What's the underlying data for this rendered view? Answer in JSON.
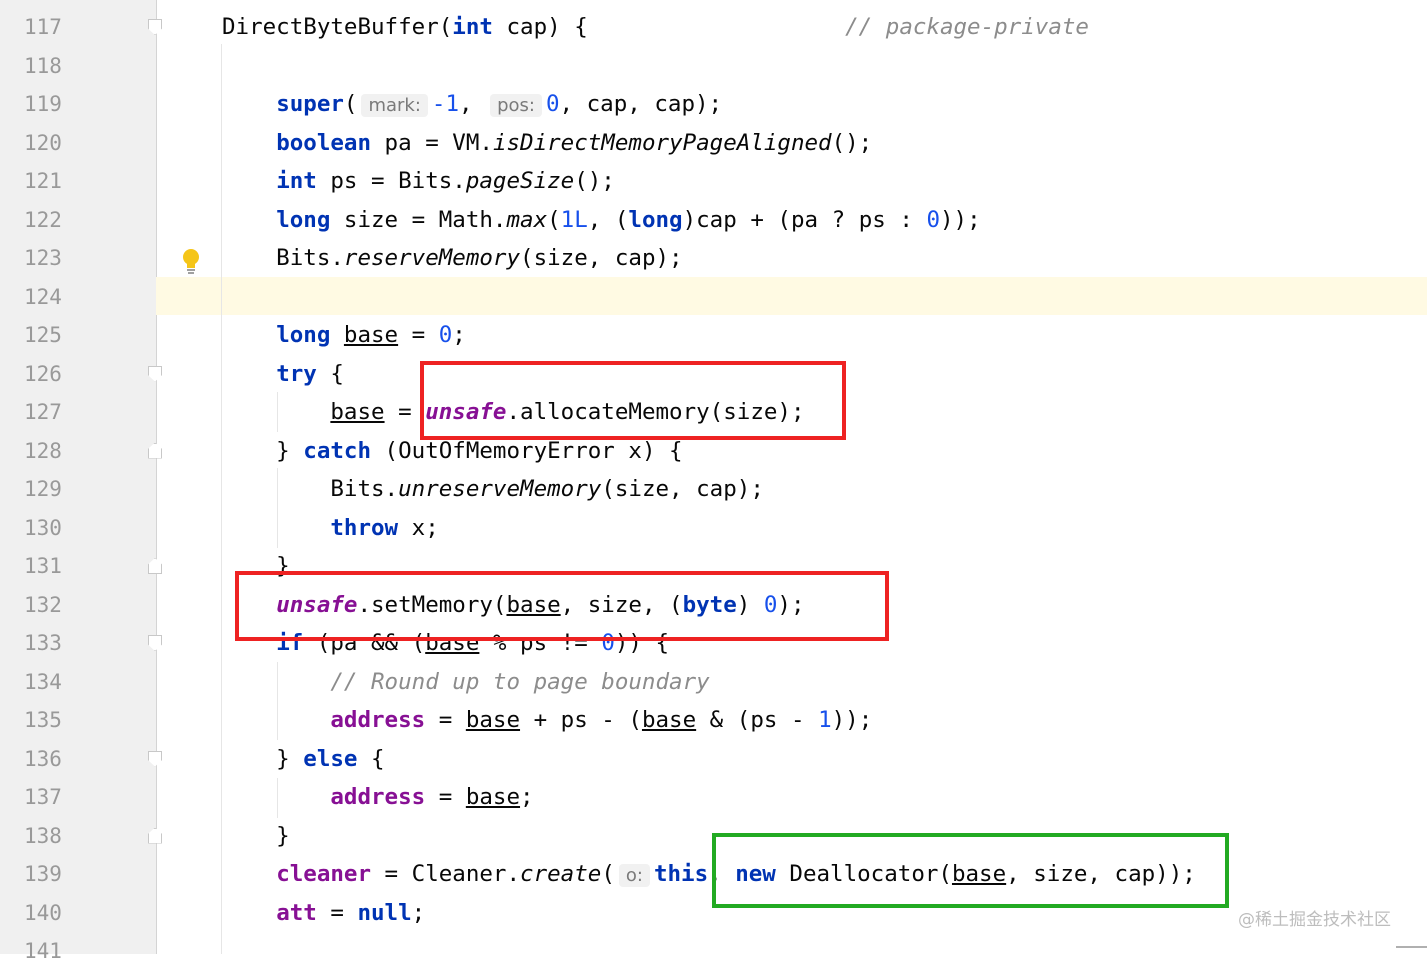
{
  "editor": {
    "line_numbers": [
      "117",
      "118",
      "119",
      "120",
      "121",
      "122",
      "123",
      "124",
      "125",
      "126",
      "127",
      "128",
      "129",
      "130",
      "131",
      "132",
      "133",
      "134",
      "135",
      "136",
      "137",
      "138",
      "139",
      "140",
      "141"
    ],
    "lines": [
      {
        "no": "117",
        "tokens": [
          [
            "p",
            "DirectByteBuffer("
          ],
          [
            "kw",
            "int"
          ],
          [
            "p",
            " cap) {                   "
          ],
          [
            "cmt",
            "// package-private"
          ]
        ]
      },
      {
        "no": "118",
        "tokens": []
      },
      {
        "no": "119",
        "tokens": [
          [
            "p",
            "    "
          ],
          [
            "kw",
            "super"
          ],
          [
            "p",
            "("
          ],
          [
            "hint",
            "mark:"
          ],
          [
            "num",
            "-1"
          ],
          [
            "p",
            ", "
          ],
          [
            "hint",
            "pos:"
          ],
          [
            "num",
            "0"
          ],
          [
            "p",
            ", cap, cap);"
          ]
        ]
      },
      {
        "no": "120",
        "tokens": [
          [
            "p",
            "    "
          ],
          [
            "kw",
            "boolean"
          ],
          [
            "p",
            " pa = VM."
          ],
          [
            "it",
            "isDirectMemoryPageAligned"
          ],
          [
            "p",
            "();"
          ]
        ]
      },
      {
        "no": "121",
        "tokens": [
          [
            "p",
            "    "
          ],
          [
            "kw",
            "int"
          ],
          [
            "p",
            " ps = Bits."
          ],
          [
            "it",
            "pageSize"
          ],
          [
            "p",
            "();"
          ]
        ]
      },
      {
        "no": "122",
        "tokens": [
          [
            "p",
            "    "
          ],
          [
            "kw",
            "long"
          ],
          [
            "p",
            " size = Math."
          ],
          [
            "it",
            "max"
          ],
          [
            "p",
            "("
          ],
          [
            "num",
            "1L"
          ],
          [
            "p",
            ", ("
          ],
          [
            "kw",
            "long"
          ],
          [
            "p",
            ")cap + (pa ? ps : "
          ],
          [
            "num",
            "0"
          ],
          [
            "p",
            "));"
          ]
        ]
      },
      {
        "no": "123",
        "tokens": [
          [
            "p",
            "    Bits."
          ],
          [
            "it",
            "reserveMemory"
          ],
          [
            "p",
            "(size, cap);"
          ]
        ]
      },
      {
        "no": "124",
        "tokens": []
      },
      {
        "no": "125",
        "tokens": [
          [
            "p",
            "    "
          ],
          [
            "kw",
            "long"
          ],
          [
            "p",
            " "
          ],
          [
            "ul",
            "base"
          ],
          [
            "p",
            " = "
          ],
          [
            "num",
            "0"
          ],
          [
            "p",
            ";"
          ]
        ]
      },
      {
        "no": "126",
        "tokens": [
          [
            "p",
            "    "
          ],
          [
            "kw",
            "try"
          ],
          [
            "p",
            " {"
          ]
        ]
      },
      {
        "no": "127",
        "tokens": [
          [
            "p",
            "        "
          ],
          [
            "ul",
            "base"
          ],
          [
            "p",
            " = "
          ],
          [
            "sfld",
            "unsafe"
          ],
          [
            "p",
            ".allocateMemory(size);"
          ]
        ]
      },
      {
        "no": "128",
        "tokens": [
          [
            "p",
            "    } "
          ],
          [
            "kw",
            "catch"
          ],
          [
            "p",
            " (OutOfMemoryError x) {"
          ]
        ]
      },
      {
        "no": "129",
        "tokens": [
          [
            "p",
            "        Bits."
          ],
          [
            "it",
            "unreserveMemory"
          ],
          [
            "p",
            "(size, cap);"
          ]
        ]
      },
      {
        "no": "130",
        "tokens": [
          [
            "p",
            "        "
          ],
          [
            "kw",
            "throw"
          ],
          [
            "p",
            " x;"
          ]
        ]
      },
      {
        "no": "131",
        "tokens": [
          [
            "p",
            "    }"
          ]
        ]
      },
      {
        "no": "132",
        "tokens": [
          [
            "p",
            "    "
          ],
          [
            "sfld",
            "unsafe"
          ],
          [
            "p",
            ".setMemory("
          ],
          [
            "ul",
            "base"
          ],
          [
            "p",
            ", size, ("
          ],
          [
            "kw",
            "byte"
          ],
          [
            "p",
            ") "
          ],
          [
            "num",
            "0"
          ],
          [
            "p",
            ");"
          ]
        ]
      },
      {
        "no": "133",
        "tokens": [
          [
            "p",
            "    "
          ],
          [
            "kw",
            "if"
          ],
          [
            "p",
            " (pa && ("
          ],
          [
            "ul",
            "base"
          ],
          [
            "p",
            " % ps != "
          ],
          [
            "num",
            "0"
          ],
          [
            "p",
            ")) {"
          ]
        ]
      },
      {
        "no": "134",
        "tokens": [
          [
            "p",
            "        "
          ],
          [
            "cmt",
            "// Round up to page boundary"
          ]
        ]
      },
      {
        "no": "135",
        "tokens": [
          [
            "p",
            "        "
          ],
          [
            "fld",
            "address"
          ],
          [
            "p",
            " = "
          ],
          [
            "ul",
            "base"
          ],
          [
            "p",
            " + ps - ("
          ],
          [
            "ul",
            "base"
          ],
          [
            "p",
            " & (ps - "
          ],
          [
            "num",
            "1"
          ],
          [
            "p",
            "));"
          ]
        ]
      },
      {
        "no": "136",
        "tokens": [
          [
            "p",
            "    } "
          ],
          [
            "kw",
            "else"
          ],
          [
            "p",
            " {"
          ]
        ]
      },
      {
        "no": "137",
        "tokens": [
          [
            "p",
            "        "
          ],
          [
            "fld",
            "address"
          ],
          [
            "p",
            " = "
          ],
          [
            "ul",
            "base"
          ],
          [
            "p",
            ";"
          ]
        ]
      },
      {
        "no": "138",
        "tokens": [
          [
            "p",
            "    }"
          ]
        ]
      },
      {
        "no": "139",
        "tokens": [
          [
            "p",
            "    "
          ],
          [
            "fld",
            "cleaner"
          ],
          [
            "p",
            " = Cleaner."
          ],
          [
            "it",
            "create"
          ],
          [
            "p",
            "("
          ],
          [
            "hint",
            "o:"
          ],
          [
            "kw",
            "this"
          ],
          [
            "p",
            ", "
          ],
          [
            "kw",
            "new"
          ],
          [
            "p",
            " Deallocator("
          ],
          [
            "ul",
            "base"
          ],
          [
            "p",
            ", size, cap));"
          ]
        ]
      },
      {
        "no": "140",
        "tokens": [
          [
            "p",
            "    "
          ],
          [
            "fld",
            "att"
          ],
          [
            "p",
            " = "
          ],
          [
            "kw",
            "null"
          ],
          [
            "p",
            ";"
          ]
        ]
      },
      {
        "no": "141",
        "tokens": []
      }
    ]
  },
  "gutter": {
    "fold_open_lines": [
      "117",
      "126",
      "133",
      "136"
    ],
    "fold_close_lines": [
      "128",
      "131",
      "138"
    ],
    "bulb_icon": "lightbulb-icon",
    "bulb_line": "123"
  },
  "current_line": "124",
  "annotations": {
    "box1_color": "#ee2222",
    "box2_color": "#ee2222",
    "box3_color": "#22aa22"
  },
  "watermark": "@稀土掘金技术社区"
}
